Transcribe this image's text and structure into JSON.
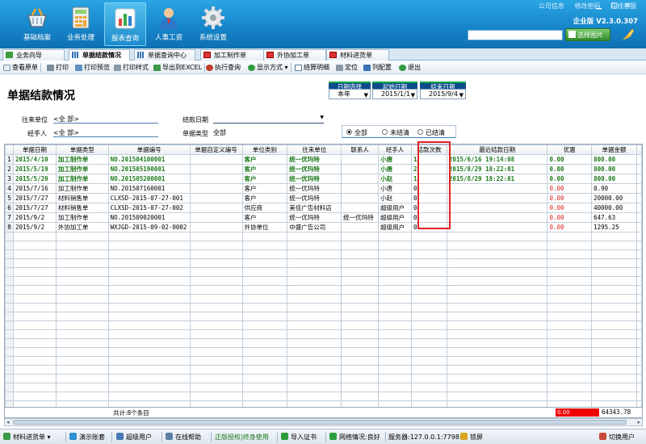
{
  "nav": [
    {
      "label": "基础档案",
      "icon": "basket-icon"
    },
    {
      "label": "业务处理",
      "icon": "calculator-icon"
    },
    {
      "label": "报表查询",
      "icon": "bar-chart-icon",
      "active": true
    },
    {
      "label": "人事工资",
      "icon": "person-icon"
    },
    {
      "label": "系统设置",
      "icon": "gear-icon"
    }
  ],
  "top_links": [
    "公司信息",
    "修改密码",
    "在线客服"
  ],
  "edition": "企业版 V2.3.0.307",
  "skin_button": "选择图片",
  "tabs": [
    "业务向导",
    "单据结款情况",
    "单据查询中心",
    "加工制作单",
    "外协加工单",
    "材料进货单"
  ],
  "toolbar": [
    "查看原单",
    "打印",
    "打印预览",
    "打印样式",
    "导出到EXCEL",
    "执行查询",
    "显示方式",
    "结算明细",
    "定位",
    "列配置",
    "退出"
  ],
  "page_title": "单据结款情况",
  "date_filter": {
    "select_label": "日期选择",
    "select_value": "本年",
    "start_label": "起始日期",
    "start_value": "2015/1/1",
    "end_label": "结束日期",
    "end_value": "2015/9/4"
  },
  "filters": {
    "partner_label": "往来单位",
    "partner_value": "<全 部>",
    "handler_label": "经手人",
    "handler_value": "<全 部>",
    "settle_date_label": "结款日期",
    "settle_date_value": "",
    "doc_type_label": "单据类型",
    "doc_type_value": "全部",
    "radios": [
      "全部",
      "未结清",
      "已结清"
    ]
  },
  "table": {
    "columns": [
      "",
      "单据日期",
      "单据类型",
      "单据编号",
      "单据自定义编号",
      "单位类别",
      "往来单位",
      "联系人",
      "经手人",
      "结款次数",
      "最近结款日期",
      "优惠",
      "单据金额"
    ],
    "rows": [
      {
        "n": "1",
        "date": "2015/4/10",
        "type": "加工制作单",
        "no": "NO.201504100001",
        "custom": "",
        "cat": "客户",
        "unit": "统一优玛特",
        "contact": "",
        "handler": "小唐",
        "times": "1",
        "last": "2015/6/16 19:14:08",
        "disc": "0.00",
        "amt": "800.00",
        "done": true
      },
      {
        "n": "2",
        "date": "2015/5/19",
        "type": "加工制作单",
        "no": "NO.201505190001",
        "custom": "",
        "cat": "客户",
        "unit": "统一优玛特",
        "contact": "",
        "handler": "小唐",
        "times": "2",
        "last": "2015/8/29 18:22:01",
        "disc": "0.00",
        "amt": "800.00",
        "done": true
      },
      {
        "n": "3",
        "date": "2015/5/20",
        "type": "加工制作单",
        "no": "NO.201505200001",
        "custom": "",
        "cat": "客户",
        "unit": "统一优玛特",
        "contact": "",
        "handler": "小赵",
        "times": "1",
        "last": "2015/8/29 18:22:01",
        "disc": "0.00",
        "amt": "800.00",
        "done": true
      },
      {
        "n": "4",
        "date": "2015/7/16",
        "type": "加工制作单",
        "no": "NO.201507160001",
        "custom": "",
        "cat": "客户",
        "unit": "统一优玛特",
        "contact": "",
        "handler": "小唐",
        "times": "0",
        "last": "",
        "disc": "0.00",
        "amt": "0.90",
        "done": false
      },
      {
        "n": "5",
        "date": "2015/7/27",
        "type": "材料销售单",
        "no": "CLXSD-2015-07-27-001",
        "custom": "",
        "cat": "客户",
        "unit": "统一优玛特",
        "contact": "",
        "handler": "小赵",
        "times": "0",
        "last": "",
        "disc": "0.00",
        "amt": "20000.00",
        "done": false
      },
      {
        "n": "6",
        "date": "2015/7/27",
        "type": "材料销售单",
        "no": "CLXSD-2015-07-27-002",
        "custom": "",
        "cat": "供应商",
        "unit": "美佳广告材料店",
        "contact": "",
        "handler": "超级用户",
        "times": "0",
        "last": "",
        "disc": "0.00",
        "amt": "40000.00",
        "done": false
      },
      {
        "n": "7",
        "date": "2015/9/2",
        "type": "加工制作单",
        "no": "NO.201509020001",
        "custom": "",
        "cat": "客户",
        "unit": "统一优玛特",
        "contact": "统一优玛特",
        "handler": "超级用户",
        "times": "0",
        "last": "",
        "disc": "0.00",
        "amt": "647.63",
        "done": false
      },
      {
        "n": "8",
        "date": "2015/9/2",
        "type": "外协加工单",
        "no": "WXJGD-2015-09-02-0002",
        "custom": "",
        "cat": "外协单位",
        "unit": "中盛广告公司",
        "contact": "",
        "handler": "超级用户",
        "times": "0",
        "last": "",
        "disc": "0.00",
        "amt": "1295.25",
        "done": false
      }
    ]
  },
  "summary": {
    "count": "共计:8个条目",
    "discount": "0.00",
    "amount": "64343.78"
  },
  "status": [
    "材料进货单",
    "演示账套",
    "超级用户",
    "在线帮助",
    "正版授权|终身使用",
    "导入证书",
    "网络情况:良好",
    "服务器:127.0.0.1:7798",
    "锁屏",
    "切换用户"
  ],
  "colors": {
    "accent": "#1584c8",
    "settled": "#1c7a1c",
    "negative": "#dd2222",
    "highlight": "#e02222"
  }
}
